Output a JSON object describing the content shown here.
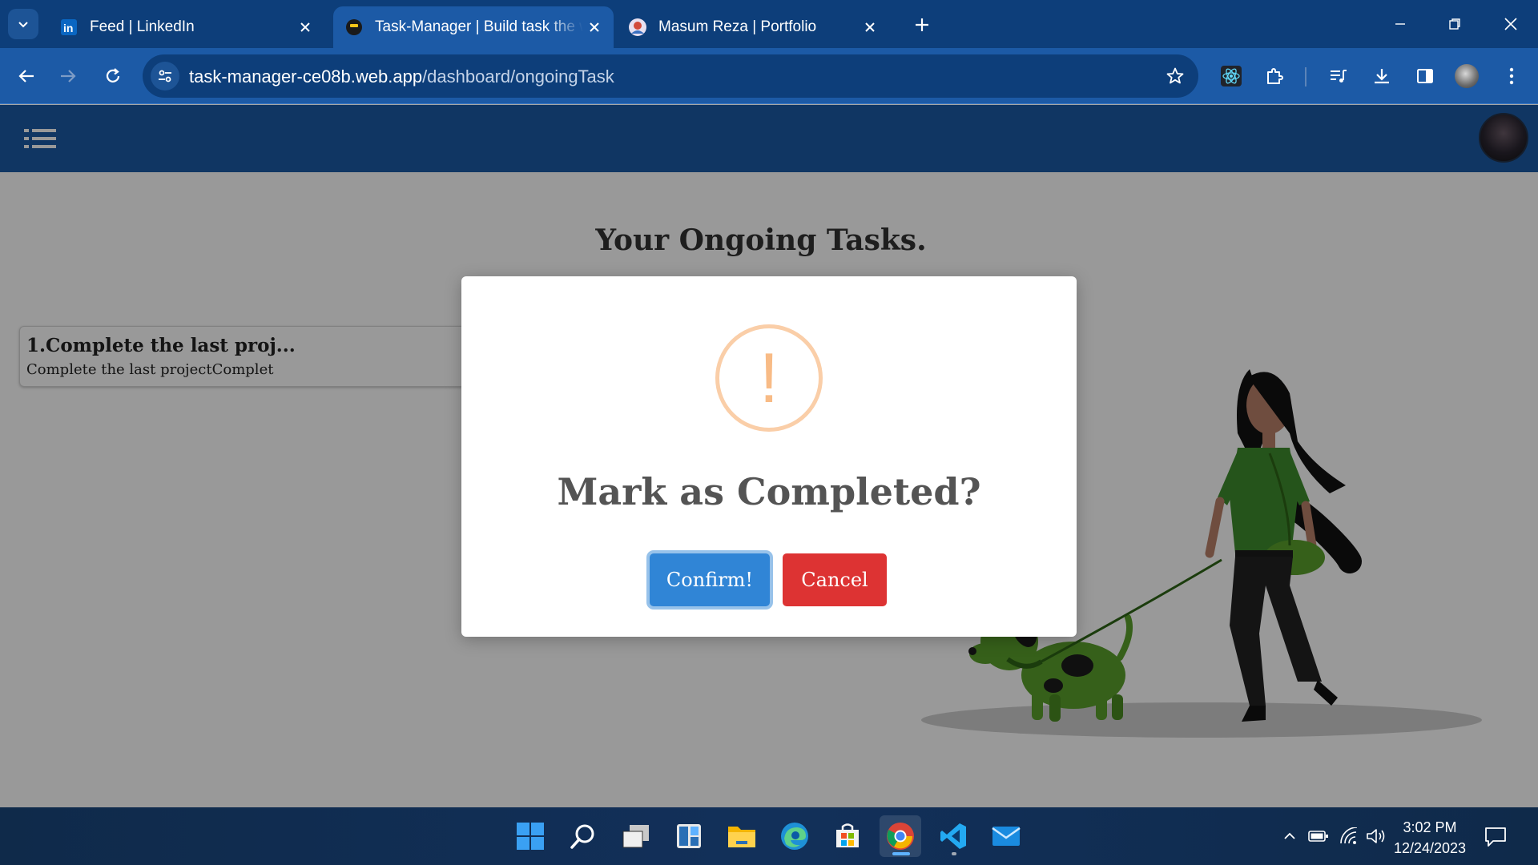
{
  "browser": {
    "tabs": [
      {
        "title": "Feed | LinkedIn",
        "favicon": "linkedin-icon"
      },
      {
        "title": "Task-Manager | Build task the w",
        "favicon": "task-manager-icon"
      },
      {
        "title": "Masum Reza | Portfolio",
        "favicon": "portfolio-icon"
      }
    ],
    "url": {
      "host": "task-manager-ce08b.web.app",
      "path": "/dashboard/ongoingTask"
    },
    "colors": {
      "tabbar": "#0d3e7a",
      "toolbar": "#1c5aa6"
    }
  },
  "page": {
    "title": "Your Ongoing Tasks.",
    "tasks": [
      {
        "title": "1.Complete the last proj...",
        "description": "Complete the last projectComplet"
      }
    ]
  },
  "modal": {
    "icon": "exclamation",
    "title": "Mark as Completed?",
    "confirm_label": "Confirm!",
    "cancel_label": "Cancel",
    "colors": {
      "confirm": "#3085d6",
      "cancel": "#dd3333",
      "icon": "#f8bb86"
    }
  },
  "taskbar": {
    "apps": [
      "windows-start",
      "search",
      "task-view",
      "widgets",
      "file-explorer",
      "edge",
      "microsoft-store",
      "chrome",
      "vscode",
      "mail"
    ],
    "time": "3:02 PM",
    "date": "12/24/2023"
  }
}
